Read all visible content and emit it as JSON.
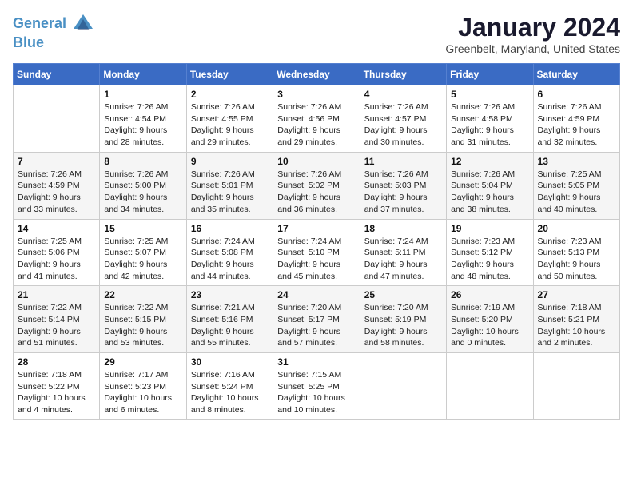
{
  "header": {
    "logo_line1": "General",
    "logo_line2": "Blue",
    "month": "January 2024",
    "location": "Greenbelt, Maryland, United States"
  },
  "days_of_week": [
    "Sunday",
    "Monday",
    "Tuesday",
    "Wednesday",
    "Thursday",
    "Friday",
    "Saturday"
  ],
  "weeks": [
    [
      {
        "day": "",
        "sunrise": "",
        "sunset": "",
        "daylight": ""
      },
      {
        "day": "1",
        "sunrise": "Sunrise: 7:26 AM",
        "sunset": "Sunset: 4:54 PM",
        "daylight": "Daylight: 9 hours and 28 minutes."
      },
      {
        "day": "2",
        "sunrise": "Sunrise: 7:26 AM",
        "sunset": "Sunset: 4:55 PM",
        "daylight": "Daylight: 9 hours and 29 minutes."
      },
      {
        "day": "3",
        "sunrise": "Sunrise: 7:26 AM",
        "sunset": "Sunset: 4:56 PM",
        "daylight": "Daylight: 9 hours and 29 minutes."
      },
      {
        "day": "4",
        "sunrise": "Sunrise: 7:26 AM",
        "sunset": "Sunset: 4:57 PM",
        "daylight": "Daylight: 9 hours and 30 minutes."
      },
      {
        "day": "5",
        "sunrise": "Sunrise: 7:26 AM",
        "sunset": "Sunset: 4:58 PM",
        "daylight": "Daylight: 9 hours and 31 minutes."
      },
      {
        "day": "6",
        "sunrise": "Sunrise: 7:26 AM",
        "sunset": "Sunset: 4:59 PM",
        "daylight": "Daylight: 9 hours and 32 minutes."
      }
    ],
    [
      {
        "day": "7",
        "sunrise": "Sunrise: 7:26 AM",
        "sunset": "Sunset: 4:59 PM",
        "daylight": "Daylight: 9 hours and 33 minutes."
      },
      {
        "day": "8",
        "sunrise": "Sunrise: 7:26 AM",
        "sunset": "Sunset: 5:00 PM",
        "daylight": "Daylight: 9 hours and 34 minutes."
      },
      {
        "day": "9",
        "sunrise": "Sunrise: 7:26 AM",
        "sunset": "Sunset: 5:01 PM",
        "daylight": "Daylight: 9 hours and 35 minutes."
      },
      {
        "day": "10",
        "sunrise": "Sunrise: 7:26 AM",
        "sunset": "Sunset: 5:02 PM",
        "daylight": "Daylight: 9 hours and 36 minutes."
      },
      {
        "day": "11",
        "sunrise": "Sunrise: 7:26 AM",
        "sunset": "Sunset: 5:03 PM",
        "daylight": "Daylight: 9 hours and 37 minutes."
      },
      {
        "day": "12",
        "sunrise": "Sunrise: 7:26 AM",
        "sunset": "Sunset: 5:04 PM",
        "daylight": "Daylight: 9 hours and 38 minutes."
      },
      {
        "day": "13",
        "sunrise": "Sunrise: 7:25 AM",
        "sunset": "Sunset: 5:05 PM",
        "daylight": "Daylight: 9 hours and 40 minutes."
      }
    ],
    [
      {
        "day": "14",
        "sunrise": "Sunrise: 7:25 AM",
        "sunset": "Sunset: 5:06 PM",
        "daylight": "Daylight: 9 hours and 41 minutes."
      },
      {
        "day": "15",
        "sunrise": "Sunrise: 7:25 AM",
        "sunset": "Sunset: 5:07 PM",
        "daylight": "Daylight: 9 hours and 42 minutes."
      },
      {
        "day": "16",
        "sunrise": "Sunrise: 7:24 AM",
        "sunset": "Sunset: 5:08 PM",
        "daylight": "Daylight: 9 hours and 44 minutes."
      },
      {
        "day": "17",
        "sunrise": "Sunrise: 7:24 AM",
        "sunset": "Sunset: 5:10 PM",
        "daylight": "Daylight: 9 hours and 45 minutes."
      },
      {
        "day": "18",
        "sunrise": "Sunrise: 7:24 AM",
        "sunset": "Sunset: 5:11 PM",
        "daylight": "Daylight: 9 hours and 47 minutes."
      },
      {
        "day": "19",
        "sunrise": "Sunrise: 7:23 AM",
        "sunset": "Sunset: 5:12 PM",
        "daylight": "Daylight: 9 hours and 48 minutes."
      },
      {
        "day": "20",
        "sunrise": "Sunrise: 7:23 AM",
        "sunset": "Sunset: 5:13 PM",
        "daylight": "Daylight: 9 hours and 50 minutes."
      }
    ],
    [
      {
        "day": "21",
        "sunrise": "Sunrise: 7:22 AM",
        "sunset": "Sunset: 5:14 PM",
        "daylight": "Daylight: 9 hours and 51 minutes."
      },
      {
        "day": "22",
        "sunrise": "Sunrise: 7:22 AM",
        "sunset": "Sunset: 5:15 PM",
        "daylight": "Daylight: 9 hours and 53 minutes."
      },
      {
        "day": "23",
        "sunrise": "Sunrise: 7:21 AM",
        "sunset": "Sunset: 5:16 PM",
        "daylight": "Daylight: 9 hours and 55 minutes."
      },
      {
        "day": "24",
        "sunrise": "Sunrise: 7:20 AM",
        "sunset": "Sunset: 5:17 PM",
        "daylight": "Daylight: 9 hours and 57 minutes."
      },
      {
        "day": "25",
        "sunrise": "Sunrise: 7:20 AM",
        "sunset": "Sunset: 5:19 PM",
        "daylight": "Daylight: 9 hours and 58 minutes."
      },
      {
        "day": "26",
        "sunrise": "Sunrise: 7:19 AM",
        "sunset": "Sunset: 5:20 PM",
        "daylight": "Daylight: 10 hours and 0 minutes."
      },
      {
        "day": "27",
        "sunrise": "Sunrise: 7:18 AM",
        "sunset": "Sunset: 5:21 PM",
        "daylight": "Daylight: 10 hours and 2 minutes."
      }
    ],
    [
      {
        "day": "28",
        "sunrise": "Sunrise: 7:18 AM",
        "sunset": "Sunset: 5:22 PM",
        "daylight": "Daylight: 10 hours and 4 minutes."
      },
      {
        "day": "29",
        "sunrise": "Sunrise: 7:17 AM",
        "sunset": "Sunset: 5:23 PM",
        "daylight": "Daylight: 10 hours and 6 minutes."
      },
      {
        "day": "30",
        "sunrise": "Sunrise: 7:16 AM",
        "sunset": "Sunset: 5:24 PM",
        "daylight": "Daylight: 10 hours and 8 minutes."
      },
      {
        "day": "31",
        "sunrise": "Sunrise: 7:15 AM",
        "sunset": "Sunset: 5:25 PM",
        "daylight": "Daylight: 10 hours and 10 minutes."
      },
      {
        "day": "",
        "sunrise": "",
        "sunset": "",
        "daylight": ""
      },
      {
        "day": "",
        "sunrise": "",
        "sunset": "",
        "daylight": ""
      },
      {
        "day": "",
        "sunrise": "",
        "sunset": "",
        "daylight": ""
      }
    ]
  ]
}
